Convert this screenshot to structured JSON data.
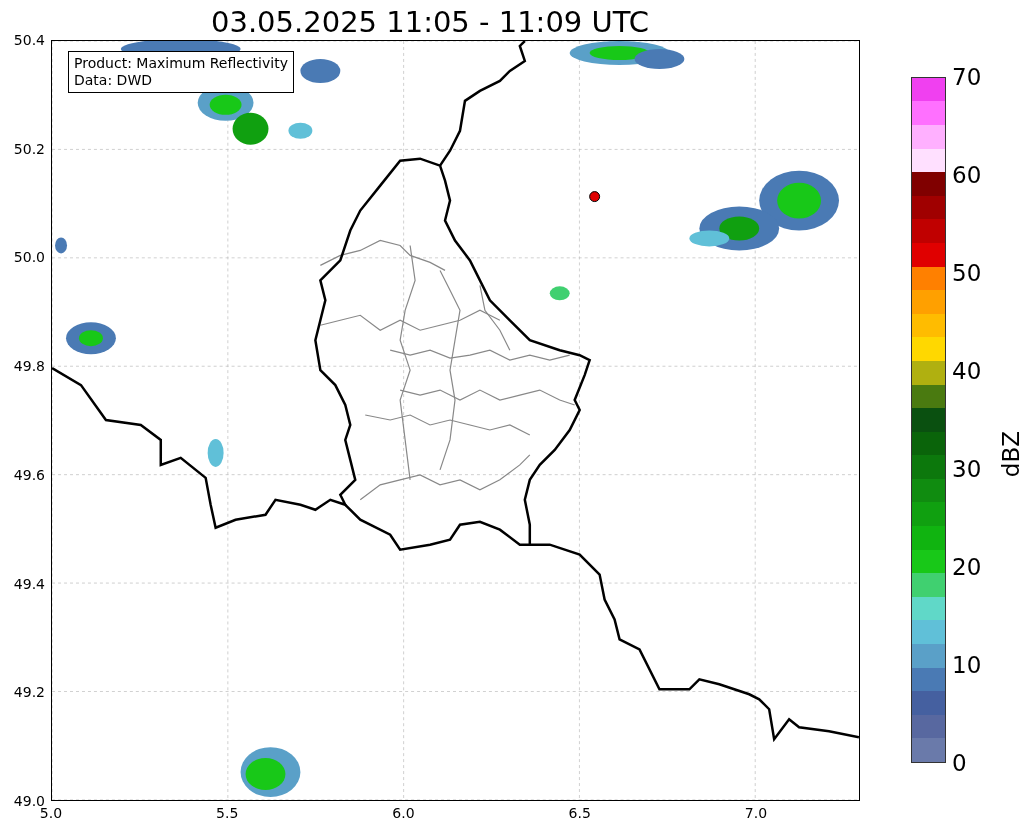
{
  "title": "03.05.2025 11:05 - 11:09 UTC",
  "map": {
    "annotation": [
      "Product: Maximum Reflectivity",
      "Data: DWD"
    ],
    "y_ticks": [
      "50.4",
      "50.2",
      "50.0",
      "49.8",
      "49.6",
      "49.4",
      "49.2",
      "49.0"
    ],
    "x_ticks": [
      "5.0",
      "5.5",
      "6.0",
      "6.5",
      "7.0"
    ]
  },
  "colorbar": {
    "label": "dBZ",
    "ticks": [
      "70",
      "60",
      "50",
      "40",
      "30",
      "20",
      "10",
      "0"
    ],
    "bins": [
      {
        "color": "#6a7aaa"
      },
      {
        "color": "#5868a0"
      },
      {
        "color": "#4560a0"
      },
      {
        "color": "#4a7ab4"
      },
      {
        "color": "#5aa0c8"
      },
      {
        "color": "#60c0d8"
      },
      {
        "color": "#60d8c8"
      },
      {
        "color": "#40d070"
      },
      {
        "color": "#18c818"
      },
      {
        "color": "#10b410"
      },
      {
        "color": "#10a010"
      },
      {
        "color": "#108c10"
      },
      {
        "color": "#0c780c"
      },
      {
        "color": "#0a640a"
      },
      {
        "color": "#0a5010"
      },
      {
        "color": "#4a7a10"
      },
      {
        "color": "#b0b010"
      },
      {
        "color": "#ffd800"
      },
      {
        "color": "#ffbc00"
      },
      {
        "color": "#ffa000"
      },
      {
        "color": "#ff8000"
      },
      {
        "color": "#e00000"
      },
      {
        "color": "#c00000"
      },
      {
        "color": "#a00000"
      },
      {
        "color": "#800000"
      },
      {
        "color": "#ffe0ff"
      },
      {
        "color": "#ffb0ff"
      },
      {
        "color": "#ff70ff"
      },
      {
        "color": "#f040f0"
      }
    ]
  }
}
